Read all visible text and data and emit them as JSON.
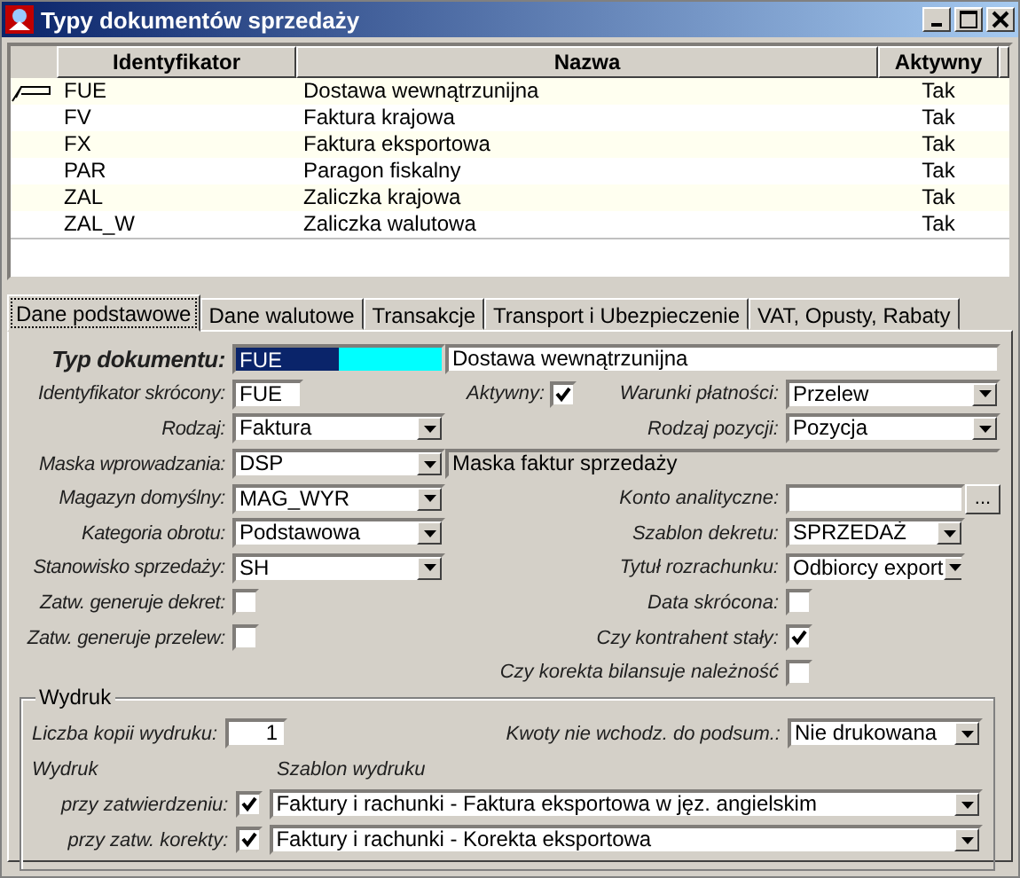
{
  "window": {
    "title": "Typy dokumentów sprzedaży",
    "buttons": [
      {
        "kind": "minimize"
      },
      {
        "kind": "maximize"
      },
      {
        "kind": "close"
      }
    ]
  },
  "grid": {
    "columns": [
      "Identyfikator",
      "Nazwa",
      "Aktywny"
    ],
    "rows": [
      {
        "id": "FUE",
        "name": "Dostawa wewnątrzunijna",
        "active": "Tak",
        "current": true
      },
      {
        "id": "FV",
        "name": "Faktura krajowa",
        "active": "Tak",
        "current": false
      },
      {
        "id": "FX",
        "name": "Faktura eksportowa",
        "active": "Tak",
        "current": false
      },
      {
        "id": "PAR",
        "name": "Paragon fiskalny",
        "active": "Tak",
        "current": false
      },
      {
        "id": "ZAL",
        "name": "Zaliczka krajowa",
        "active": "Tak",
        "current": false
      },
      {
        "id": "ZAL_W",
        "name": "Zaliczka walutowa",
        "active": "Tak",
        "current": false
      }
    ]
  },
  "tabs": [
    {
      "label": "Dane podstawowe",
      "selected": true
    },
    {
      "label": "Dane walutowe",
      "selected": false
    },
    {
      "label": "Transakcje",
      "selected": false
    },
    {
      "label": "Transport i Ubezpieczenie",
      "selected": false
    },
    {
      "label": "VAT, Opusty, Rabaty",
      "selected": false
    }
  ],
  "form": {
    "rows": [
      {
        "left": {
          "kind": "key",
          "label": "Typ dokumentu:",
          "value": "FUE"
        },
        "middle": {
          "kind": "wide",
          "value": "Dostawa wewnątrzunijna"
        }
      },
      {
        "left": {
          "kind": "code",
          "label": "Identyfikator skrócony:",
          "value": "FUE"
        },
        "middle": {
          "kind": "checkbox",
          "label": "Aktywny:",
          "checked": true
        },
        "right": {
          "kind": "select",
          "label": "Warunki płatności:",
          "value": "Przelew"
        }
      },
      {
        "left": {
          "kind": "select",
          "label": "Rodzaj:",
          "value": "Faktura"
        },
        "right": {
          "kind": "select",
          "label": "Rodzaj pozycji:",
          "value": "Pozycja"
        }
      },
      {
        "left": {
          "kind": "select",
          "label": "Maska wprowadzania:",
          "value": "DSP"
        },
        "middle": {
          "kind": "readonly",
          "value": "Maska faktur sprzedaży"
        }
      },
      {
        "left": {
          "kind": "select",
          "label": "Magazyn domyślny:",
          "value": "MAG_WYR"
        },
        "right": {
          "kind": "lookup",
          "label": "Konto analityczne:",
          "button": "..."
        }
      },
      {
        "left": {
          "kind": "select",
          "label": "Kategoria obrotu:",
          "value": "Podstawowa"
        },
        "right": {
          "kind": "combo",
          "label": "Szablon dekretu:",
          "value": "SPRZEDAŻ"
        }
      },
      {
        "left": {
          "kind": "select",
          "label": "Stanowisko sprzedaży:",
          "value": "SH"
        },
        "right": {
          "kind": "combo",
          "label": "Tytuł rozrachunku:",
          "value": "Odbiorcy export"
        }
      },
      {
        "left": {
          "kind": "checkbox",
          "label": "Zatw. generuje dekret:",
          "checked": false
        },
        "right": {
          "kind": "checkbox",
          "label": "Data skrócona:",
          "checked": false
        }
      },
      {
        "left": {
          "kind": "checkbox",
          "label": "Zatw. generuje przelew:",
          "checked": false
        },
        "right": {
          "kind": "checkbox",
          "label": "Czy kontrahent stały:",
          "checked": true
        }
      },
      {
        "right": {
          "kind": "checkbox",
          "label": "Czy korekta bilansuje należność",
          "checked": false
        }
      }
    ]
  },
  "print": {
    "legend": "Wydruk",
    "copies_label": "Liczba kopii wydruku:",
    "copies": "1",
    "amounts_label": "Kwoty nie wchodz. do podsum.:",
    "amounts": "Nie drukowana",
    "col_print": "Wydruk",
    "col_template": "Szablon wydruku",
    "rows": [
      {
        "label": "przy zatwierdzeniu:",
        "checked": true,
        "template": "Faktury i rachunki - Faktura eksportowa w jęz. angielskim"
      },
      {
        "label": "przy zatw. korekty:",
        "checked": true,
        "template": "Faktury i rachunki - Korekta eksportowa"
      }
    ]
  }
}
